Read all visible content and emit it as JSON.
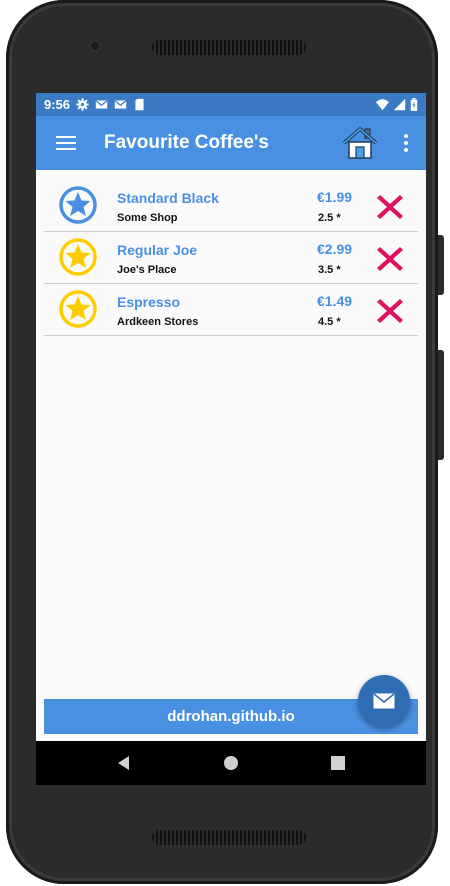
{
  "status_bar": {
    "time": "9:56",
    "icons": [
      "gear-icon",
      "gmail-icon",
      "gmail-icon",
      "sd-card-icon"
    ],
    "right_icons": [
      "wifi-icon",
      "signal-icon",
      "battery-icon"
    ]
  },
  "app_bar": {
    "title": "Favourite Coffee's",
    "home_icon": "home-icon",
    "more_icon": "more-vert-icon",
    "menu_icon": "menu-icon"
  },
  "coffees": [
    {
      "name": "Standard Black",
      "shop": "Some Shop",
      "price": "€1.99",
      "rating": "2.5 *",
      "favourite": false
    },
    {
      "name": "Regular Joe",
      "shop": "Joe's Place",
      "price": "€2.99",
      "rating": "3.5 *",
      "favourite": true
    },
    {
      "name": "Espresso",
      "shop": "Ardkeen Stores",
      "price": "€1.49",
      "rating": "4.5 *",
      "favourite": true
    }
  ],
  "footer": {
    "text": "ddrohan.github.io"
  },
  "fab": {
    "icon": "email-icon"
  },
  "nav_bar": {
    "icons": [
      "back-icon",
      "home-circle-icon",
      "recents-icon"
    ]
  },
  "colors": {
    "primary": "#4a90e2",
    "status_bar": "#3b7bc6",
    "fab": "#2f6db5",
    "favourite_star": "#ffcc00",
    "delete": "#e0115f"
  }
}
